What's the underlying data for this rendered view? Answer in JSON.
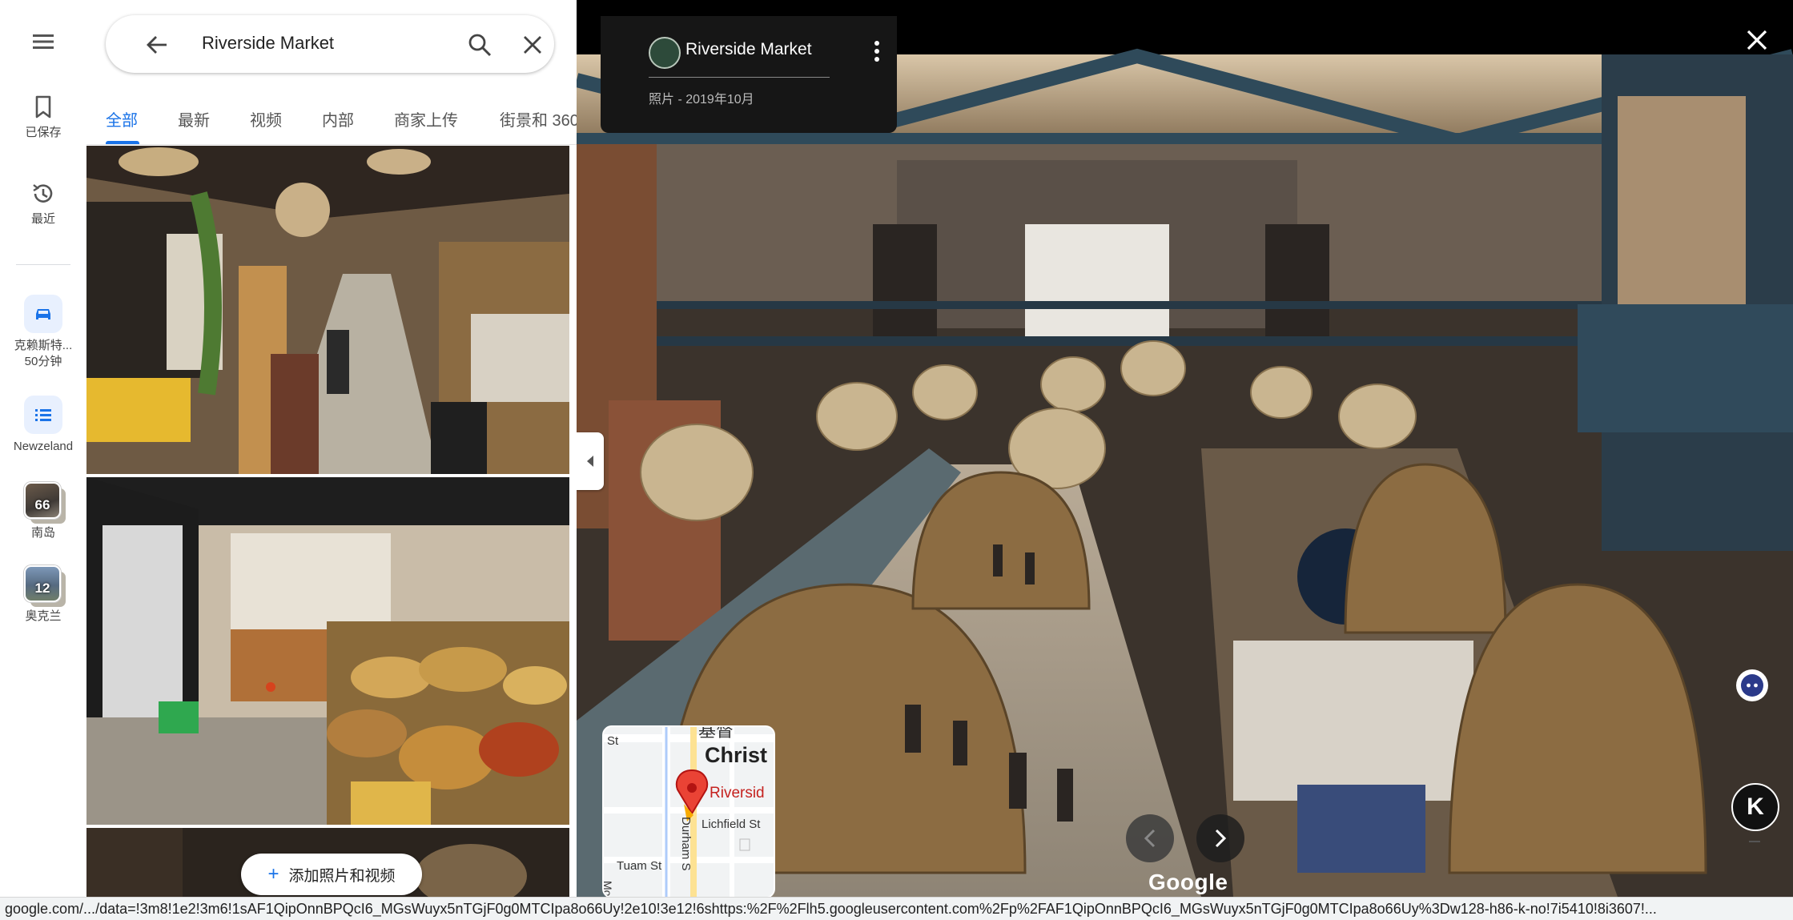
{
  "rail": {
    "saved_label": "已保存",
    "recent_label": "最近",
    "items": [
      {
        "label_line1": "克赖斯特...",
        "label_line2": "50分钟"
      },
      {
        "label": "Newzeland"
      },
      {
        "label": "南岛",
        "count": "66"
      },
      {
        "label": "奥克兰",
        "count": "12"
      }
    ]
  },
  "search": {
    "query": "Riverside Market"
  },
  "tabs": [
    "全部",
    "最新",
    "视频",
    "内部",
    "商家上传",
    "街景和 360"
  ],
  "add_media_label": "添加照片和视频",
  "viewer": {
    "place_title": "Riverside Market",
    "photo_date": "照片 - 2019年10月",
    "brand": "Google",
    "minimap": {
      "city": "Christ",
      "poi": "Riversid",
      "street1": "Lichfield St",
      "street2": "Durham S",
      "street3": "Tuam St",
      "street4": "Montr",
      "street5": "St",
      "char": "基督"
    },
    "k_label": "K"
  },
  "status_url": "google.com/.../data=!3m8!1e2!3m6!1sAF1QipOnnBPQcI6_MGsWuyx5nTGjF0g0MTCIpa8o66Uy!2e10!3e12!6shttps:%2F%2Flh5.googleusercontent.com%2Fp%2FAF1QipOnnBPQcI6_MGsWuyx5nTGjF0g0MTCIpa8o66Uy%3Dw128-h86-k-no!7i5410!8i3607!..."
}
